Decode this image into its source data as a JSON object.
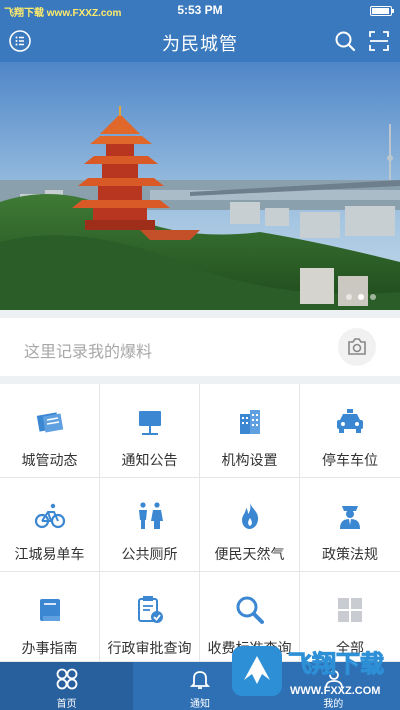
{
  "status_bar": {
    "watermark": "飞翔下载 www.FXXZ.com",
    "time": "5:53 PM"
  },
  "nav": {
    "title": "为民城管",
    "menu_icon": "menu-list-icon",
    "search_icon": "search-icon",
    "scan_icon": "scan-icon"
  },
  "banner": {
    "scene": "yellow-crane-tower-cityscape",
    "slide_count": 3,
    "active_slide": 2
  },
  "report": {
    "placeholder": "这里记录我的爆料",
    "camera_icon": "camera-icon"
  },
  "grid": {
    "items": [
      {
        "label": "城管动态",
        "icon": "news-icon"
      },
      {
        "label": "通知公告",
        "icon": "notice-board-icon"
      },
      {
        "label": "机构设置",
        "icon": "building-icon"
      },
      {
        "label": "停车车位",
        "icon": "car-icon"
      },
      {
        "label": "江城易单车",
        "icon": "bicycle-icon"
      },
      {
        "label": "公共厕所",
        "icon": "restroom-icon"
      },
      {
        "label": "便民天然气",
        "icon": "flame-icon"
      },
      {
        "label": "政策法规",
        "icon": "police-icon"
      },
      {
        "label": "办事指南",
        "icon": "book-icon"
      },
      {
        "label": "行政审批查询",
        "icon": "approval-icon"
      },
      {
        "label": "收费标准查询",
        "icon": "magnifier-icon"
      },
      {
        "label": "全部",
        "icon": "all-grid-icon"
      }
    ]
  },
  "tabs": [
    {
      "label": "首页",
      "icon": "home-grid-icon",
      "active": true
    },
    {
      "label": "通知",
      "icon": "bell-icon",
      "active": false
    },
    {
      "label": "我的",
      "icon": "user-icon",
      "active": false
    }
  ],
  "overlay": {
    "brand": "飞翔下载",
    "url": "WWW.FXXZ.COM"
  },
  "colors": {
    "primary": "#3a79bd",
    "icon_blue": "#3c87d2",
    "tab_bar": "#2f6fb4",
    "placeholder": "#a8a8a8"
  }
}
